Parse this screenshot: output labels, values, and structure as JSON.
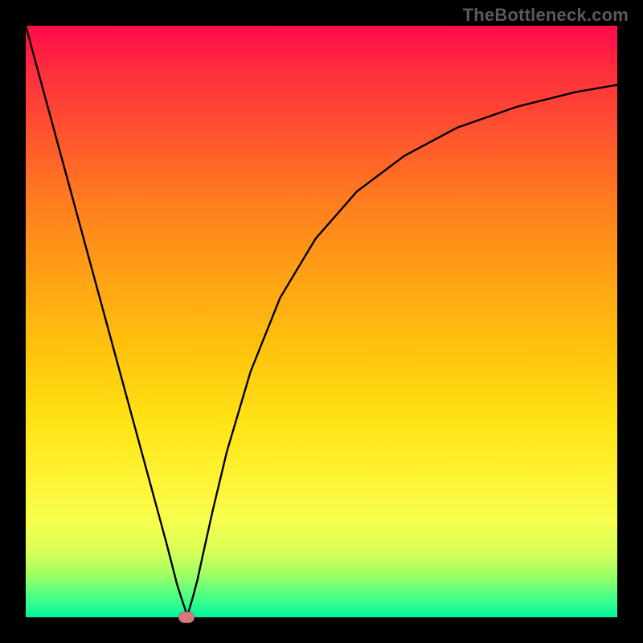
{
  "watermark": {
    "text": "TheBottleneck.com"
  },
  "chart_data": {
    "type": "line",
    "title": "",
    "xlabel": "",
    "ylabel": "",
    "xlim": [
      0,
      1
    ],
    "ylim": [
      0,
      1
    ],
    "x_of_min": 0.272,
    "series": [
      {
        "name": "bottleneck-curve",
        "x": [
          0.0,
          0.034,
          0.068,
          0.102,
          0.136,
          0.17,
          0.204,
          0.238,
          0.256,
          0.264,
          0.27,
          0.272,
          0.276,
          0.282,
          0.29,
          0.3,
          0.316,
          0.34,
          0.38,
          0.43,
          0.49,
          0.56,
          0.64,
          0.73,
          0.83,
          0.93,
          1.0
        ],
        "y": [
          1.0,
          0.875,
          0.75,
          0.625,
          0.5,
          0.375,
          0.25,
          0.125,
          0.055,
          0.03,
          0.012,
          0.0,
          0.012,
          0.032,
          0.062,
          0.108,
          0.18,
          0.28,
          0.415,
          0.54,
          0.64,
          0.72,
          0.78,
          0.828,
          0.863,
          0.888,
          0.9
        ]
      }
    ],
    "marker": {
      "x": 0.272,
      "y": 0.0,
      "color": "#d77a7e"
    },
    "background": {
      "gradient_top": "#ff0a4a",
      "gradient_bottom": "#00f5a0"
    }
  }
}
